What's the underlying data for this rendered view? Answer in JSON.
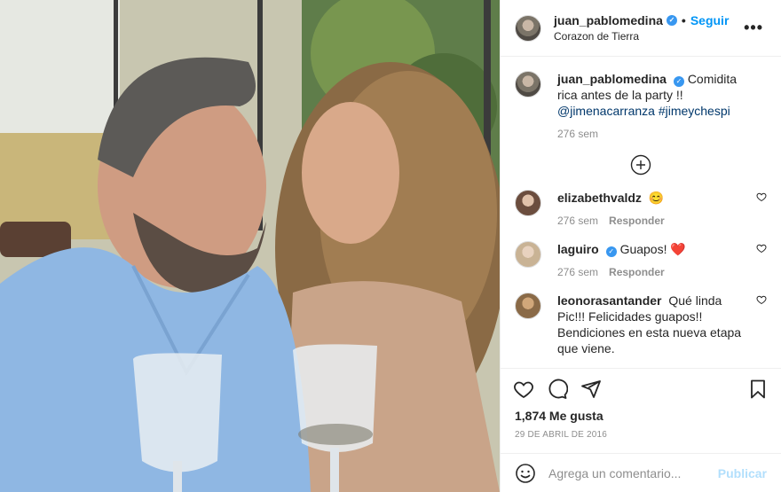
{
  "post": {
    "username": "juan_pablomedina",
    "follow_label": "Seguir",
    "separator": "•",
    "location": "Corazon de Tierra",
    "more_label": "•••"
  },
  "caption": {
    "username": "juan_pablomedina",
    "text": "Comidita rica antes de la party !! ",
    "mention": "@jimenacarranza",
    "hashtag": "#jimeychespi",
    "time": "276 sem"
  },
  "comments": [
    {
      "username": "elizabethvaldz",
      "text": "😊",
      "time": "276 sem",
      "reply": "Responder"
    },
    {
      "username": "laguiro",
      "text": "Guapos! ❤️",
      "time": "276 sem",
      "reply": "Responder"
    },
    {
      "username": "leonorasantander",
      "text": "Qué linda Pic!!! Felicidades guapos!! Bendiciones en esta nueva etapa que viene."
    }
  ],
  "likes": "1,874 Me gusta",
  "date": "29 DE ABRIL DE 2016",
  "add_comment": {
    "placeholder": "Agrega un comentario...",
    "publish_label": "Publicar"
  },
  "colors": {
    "accent": "#0095f6",
    "publish_disabled": "#b2dffc",
    "heart_red": "#ed4956"
  },
  "icons": [
    "verified-badge-icon",
    "more-options-icon",
    "load-more-plus-icon",
    "heart-icon",
    "comment-icon",
    "share-icon",
    "save-icon",
    "emoji-icon"
  ]
}
